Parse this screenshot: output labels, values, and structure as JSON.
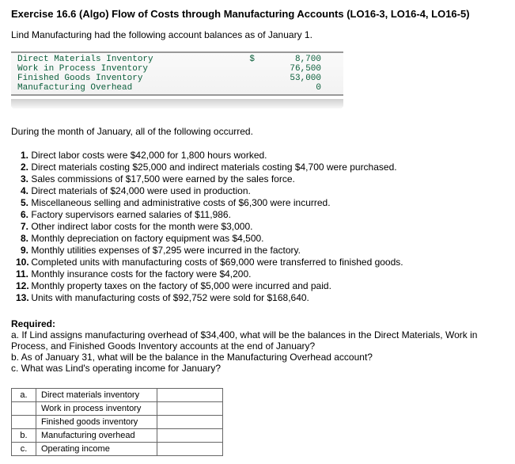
{
  "title": "Exercise 16.6 (Algo) Flow of Costs through Manufacturing Accounts (LO16-3, LO16-4, LO16-5)",
  "intro": "Lind Manufacturing had the following account balances as of January 1.",
  "accounts": {
    "currency": "$",
    "rows": [
      {
        "name": "Direct Materials Inventory",
        "value": "8,700"
      },
      {
        "name": "Work in Process Inventory",
        "value": "76,500"
      },
      {
        "name": "Finished Goods Inventory",
        "value": "53,000"
      },
      {
        "name": "Manufacturing Overhead",
        "value": "0"
      }
    ]
  },
  "during": "During the month of January, all of the following occurred.",
  "items": [
    "Direct labor costs were $42,000 for 1,800 hours worked.",
    "Direct materials costing $25,000 and indirect materials costing $4,700 were purchased.",
    "Sales commissions of $17,500 were earned by the sales force.",
    "Direct materials of $24,000 were used in production.",
    "Miscellaneous selling and administrative costs of $6,300 were incurred.",
    "Factory supervisors earned salaries of $11,986.",
    "Other indirect labor costs for the month were $3,000.",
    "Monthly depreciation on factory equipment was $4,500.",
    "Monthly utilities expenses of $7,295 were incurred in the factory.",
    "Completed units with manufacturing costs of $69,000 were transferred to finished goods.",
    "Monthly insurance costs for the factory were $4,200.",
    "Monthly property taxes on the factory of $5,000 were incurred and paid.",
    "Units with manufacturing costs of $92,752 were sold for $168,640."
  ],
  "required": {
    "heading": "Required:",
    "a": "a. If Lind assigns manufacturing overhead of $34,400, what will be the balances in the Direct Materials, Work in Process, and Finished Goods Inventory accounts at the end of January?",
    "b": "b. As of January 31, what will be the balance in the Manufacturing Overhead account?",
    "c": "c. What was Lind's operating income for January?"
  },
  "answer_table": {
    "rows": [
      {
        "label": "a.",
        "desc": "Direct materials inventory"
      },
      {
        "label": "",
        "desc": "Work in process inventory"
      },
      {
        "label": "",
        "desc": "Finished goods inventory"
      },
      {
        "label": "b.",
        "desc": "Manufacturing overhead"
      },
      {
        "label": "c.",
        "desc": "Operating income"
      }
    ]
  }
}
